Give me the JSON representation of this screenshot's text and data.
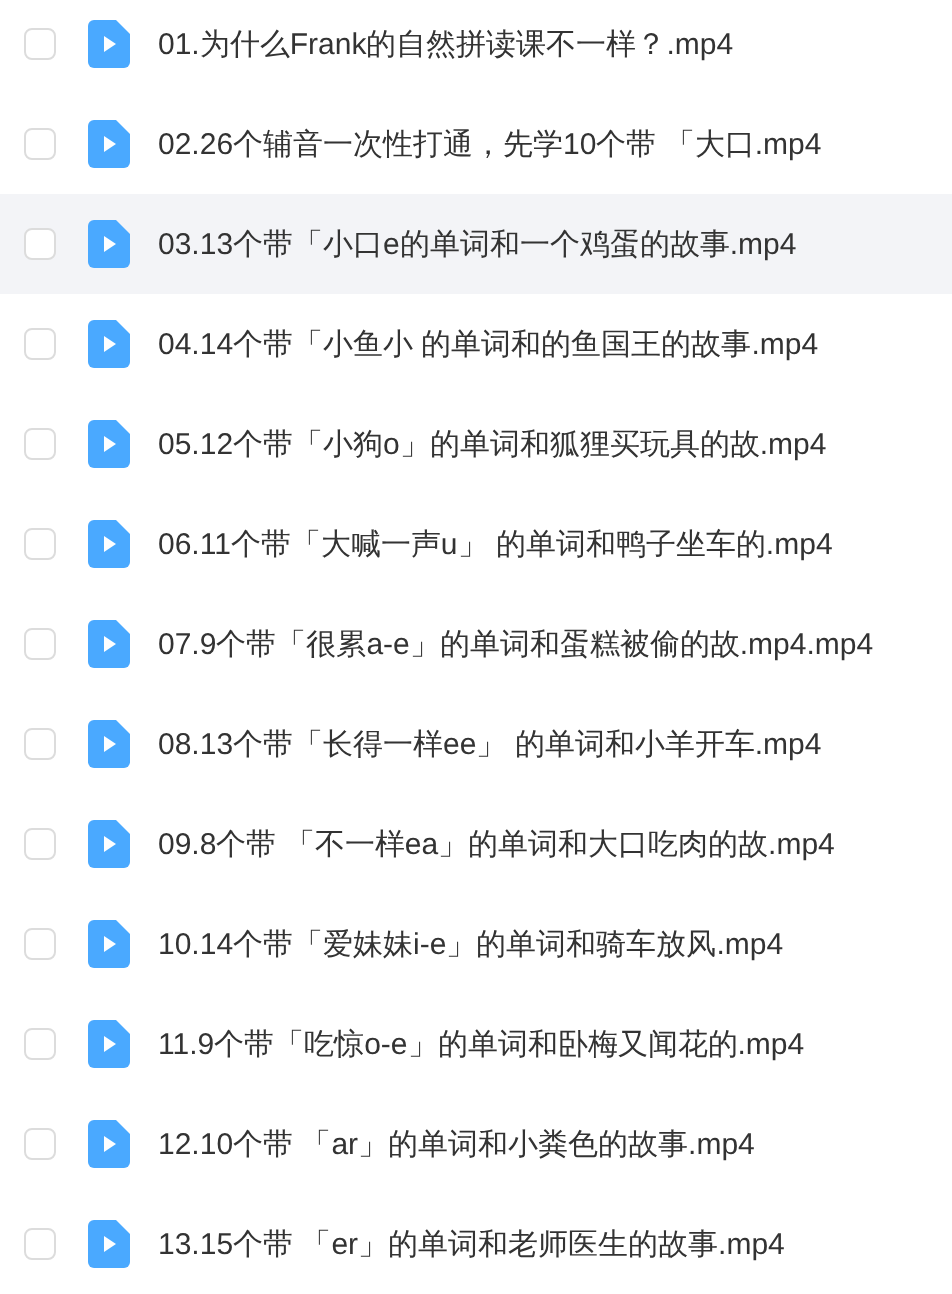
{
  "files": [
    {
      "name": "01.为什么Frank的自然拼读课不一样？.mp4",
      "checked": false,
      "highlighted": false
    },
    {
      "name": "02.26个辅音一次性打通，先学10个带 「大口.mp4",
      "checked": false,
      "highlighted": false
    },
    {
      "name": "03.13个带「小口e的单词和一个鸡蛋的故事.mp4",
      "checked": false,
      "highlighted": true
    },
    {
      "name": "04.14个带「小鱼小 的单词和的鱼国王的故事.mp4",
      "checked": false,
      "highlighted": false
    },
    {
      "name": "05.12个带「小狗o」的单词和狐狸买玩具的故.mp4",
      "checked": false,
      "highlighted": false
    },
    {
      "name": "06.11个带「大喊一声u」 的单词和鸭子坐车的.mp4",
      "checked": false,
      "highlighted": false
    },
    {
      "name": "07.9个带「很累a-e」的单词和蛋糕被偷的故.mp4.mp4",
      "checked": false,
      "highlighted": false
    },
    {
      "name": "08.13个带「长得一样ee」 的单词和小羊开车.mp4",
      "checked": false,
      "highlighted": false
    },
    {
      "name": "09.8个带 「不一样ea」的单词和大口吃肉的故.mp4",
      "checked": false,
      "highlighted": false
    },
    {
      "name": "10.14个带「爱妹妹i-e」的单词和骑车放风.mp4",
      "checked": false,
      "highlighted": false
    },
    {
      "name": "11.9个带「吃惊o-e」的单词和卧梅又闻花的.mp4",
      "checked": false,
      "highlighted": false
    },
    {
      "name": "12.10个带 「ar」的单词和小粪色的故事.mp4",
      "checked": false,
      "highlighted": false
    },
    {
      "name": "13.15个带 「er」的单词和老师医生的故事.mp4",
      "checked": false,
      "highlighted": false
    }
  ]
}
